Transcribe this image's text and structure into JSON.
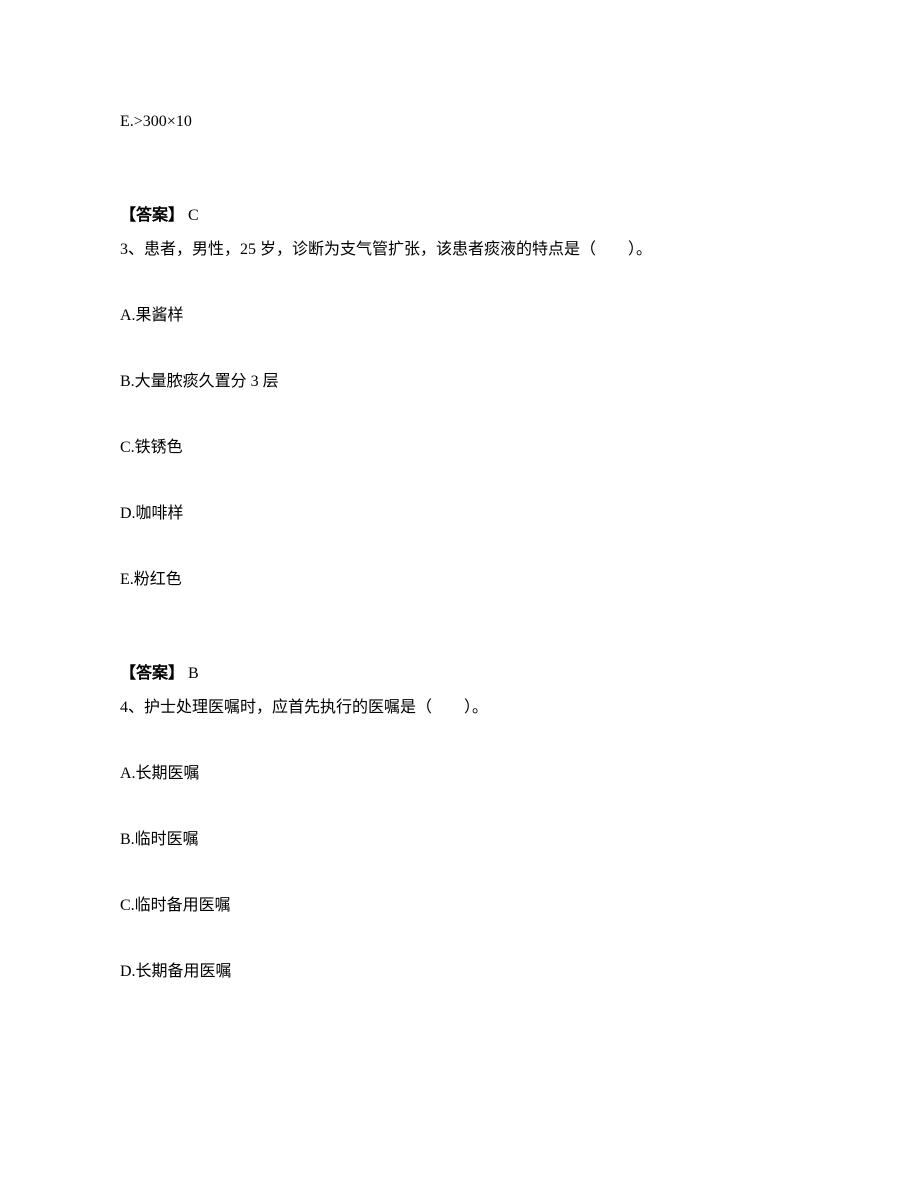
{
  "q2": {
    "optionE": "E.>300×10",
    "answerLabel": "【答案】",
    "answerValue": "C"
  },
  "q3": {
    "number": "3、",
    "text": "患者，男性，25 岁，诊断为支气管扩张，该患者痰液的特点是（　　）。",
    "optionA": "A.果酱样",
    "optionB": "B.大量脓痰久置分 3 层",
    "optionC": "C.铁锈色",
    "optionD": "D.咖啡样",
    "optionE": "E.粉红色",
    "answerLabel": "【答案】",
    "answerValue": "B"
  },
  "q4": {
    "number": "4、",
    "text": "护士处理医嘱时，应首先执行的医嘱是（　　）。",
    "optionA": "A.长期医嘱",
    "optionB": "B.临时医嘱",
    "optionC": "C.临时备用医嘱",
    "optionD": "D.长期备用医嘱"
  }
}
